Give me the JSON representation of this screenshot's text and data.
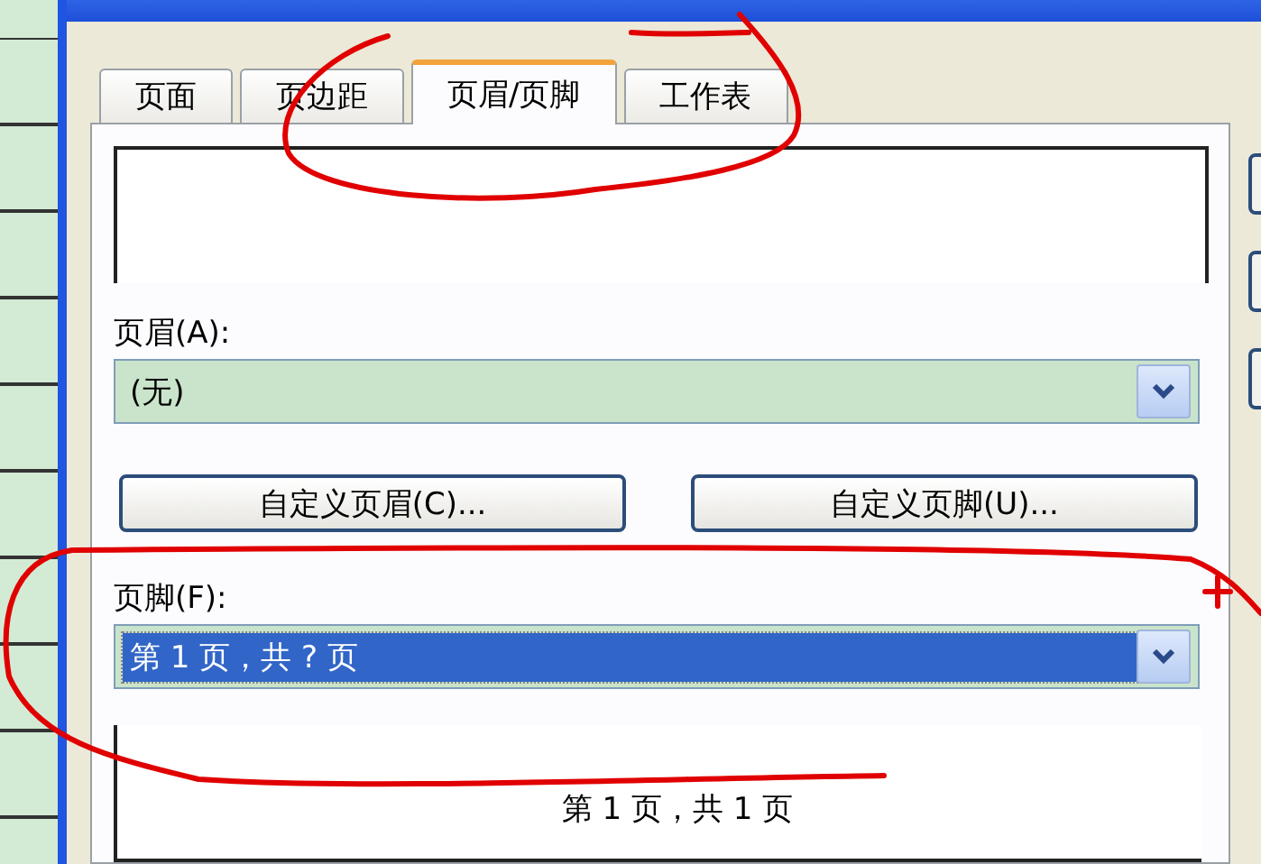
{
  "tabs": [
    {
      "label": "页面",
      "selected": false
    },
    {
      "label": "页边距",
      "selected": false
    },
    {
      "label": "页眉/页脚",
      "selected": true
    },
    {
      "label": "工作表",
      "selected": false
    }
  ],
  "header": {
    "label": "页眉(A):",
    "value": "(无)"
  },
  "buttons": [
    "自定义页眉(C)...",
    "自定义页脚(U)..."
  ],
  "footer": {
    "label": "页脚(F):",
    "value": "第 1 页，共 ? 页",
    "selected": true
  },
  "footer_preview": {
    "text": "第 1 页，共 1 页"
  }
}
